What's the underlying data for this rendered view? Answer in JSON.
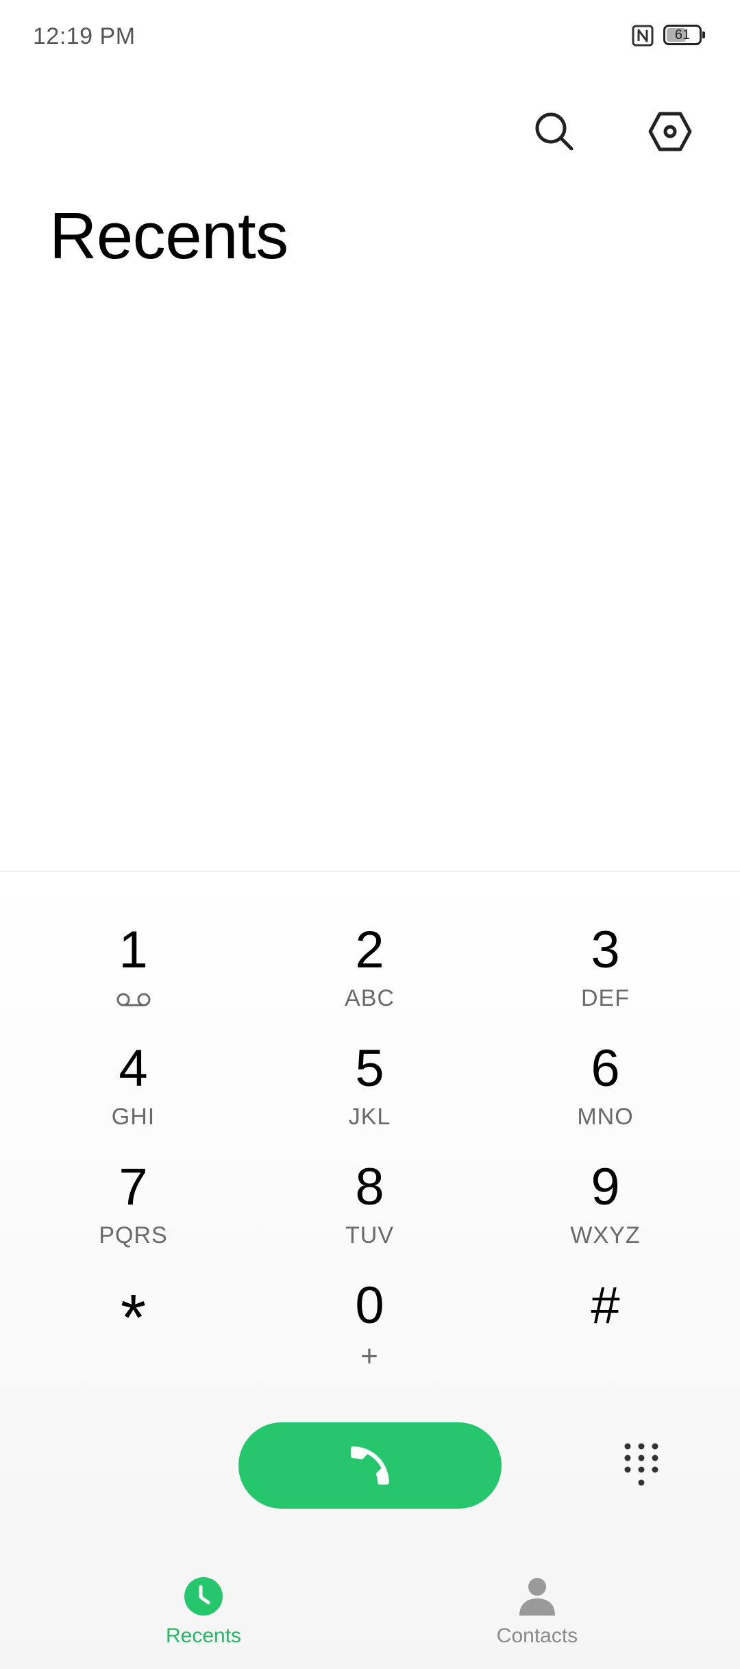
{
  "status_bar": {
    "time": "12:19 PM",
    "battery_level": "61",
    "battery_fraction": 0.61
  },
  "header": {
    "title": "Recents",
    "search_icon": "search-icon",
    "settings_icon": "settings-hexagon-icon"
  },
  "dialpad": {
    "keys": [
      {
        "digit": "1",
        "letters": "",
        "icon": "voicemail-icon"
      },
      {
        "digit": "2",
        "letters": "ABC"
      },
      {
        "digit": "3",
        "letters": "DEF"
      },
      {
        "digit": "4",
        "letters": "GHI"
      },
      {
        "digit": "5",
        "letters": "JKL"
      },
      {
        "digit": "6",
        "letters": "MNO"
      },
      {
        "digit": "7",
        "letters": "PQRS"
      },
      {
        "digit": "8",
        "letters": "TUV"
      },
      {
        "digit": "9",
        "letters": "WXYZ"
      },
      {
        "digit": "*",
        "letters": ""
      },
      {
        "digit": "0",
        "letters": "+"
      },
      {
        "digit": "#",
        "letters": ""
      }
    ],
    "call_icon": "phone-icon",
    "toggle_icon": "dialpad-icon"
  },
  "bottom_nav": {
    "items": [
      {
        "label": "Recents",
        "icon": "clock-icon",
        "active": true
      },
      {
        "label": "Contacts",
        "icon": "person-icon",
        "active": false
      }
    ]
  },
  "colors": {
    "accent": "#26c66c",
    "accent_text": "#26b866",
    "secondary_text": "#6a6a6a",
    "inactive_nav": "#8a8a8a"
  }
}
